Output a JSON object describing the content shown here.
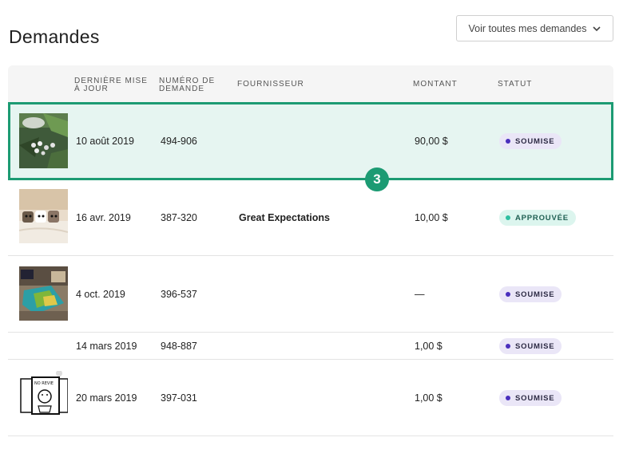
{
  "header": {
    "title": "Demandes",
    "view_all_label": "Voir toutes mes demandes"
  },
  "table": {
    "columns": {
      "updated": [
        "Dernière mise",
        "à jour"
      ],
      "number": [
        "Numéro de",
        "demande"
      ],
      "supplier": "Fournisseur",
      "amount": "Montant",
      "status": "Statut"
    },
    "rows": [
      {
        "date": "10 août 2019",
        "number": "494-906",
        "supplier": "",
        "amount": "90,00 $",
        "status": "SOUMISE"
      },
      {
        "date": "16 avr. 2019",
        "number": "387-320",
        "supplier": "Great Expectations",
        "amount": "10,00 $",
        "status": "APPROUVÉE"
      },
      {
        "date": "4 oct. 2019",
        "number": "396-537",
        "supplier": "",
        "amount": "—",
        "status": "SOUMISE"
      },
      {
        "date": "14 mars 2019",
        "number": "948-887",
        "supplier": "",
        "amount": "1,00 $",
        "status": "SOUMISE"
      },
      {
        "date": "20 mars 2019",
        "number": "397-031",
        "supplier": "",
        "amount": "1,00 $",
        "status": "SOUMISE"
      }
    ]
  },
  "marker": {
    "label": "3"
  },
  "colors": {
    "highlight_border": "#1c9b73",
    "highlight_bg": "#e6f5f1",
    "soumise_dot": "#4a2fbd",
    "approuvee_dot": "#2fbfa1"
  }
}
